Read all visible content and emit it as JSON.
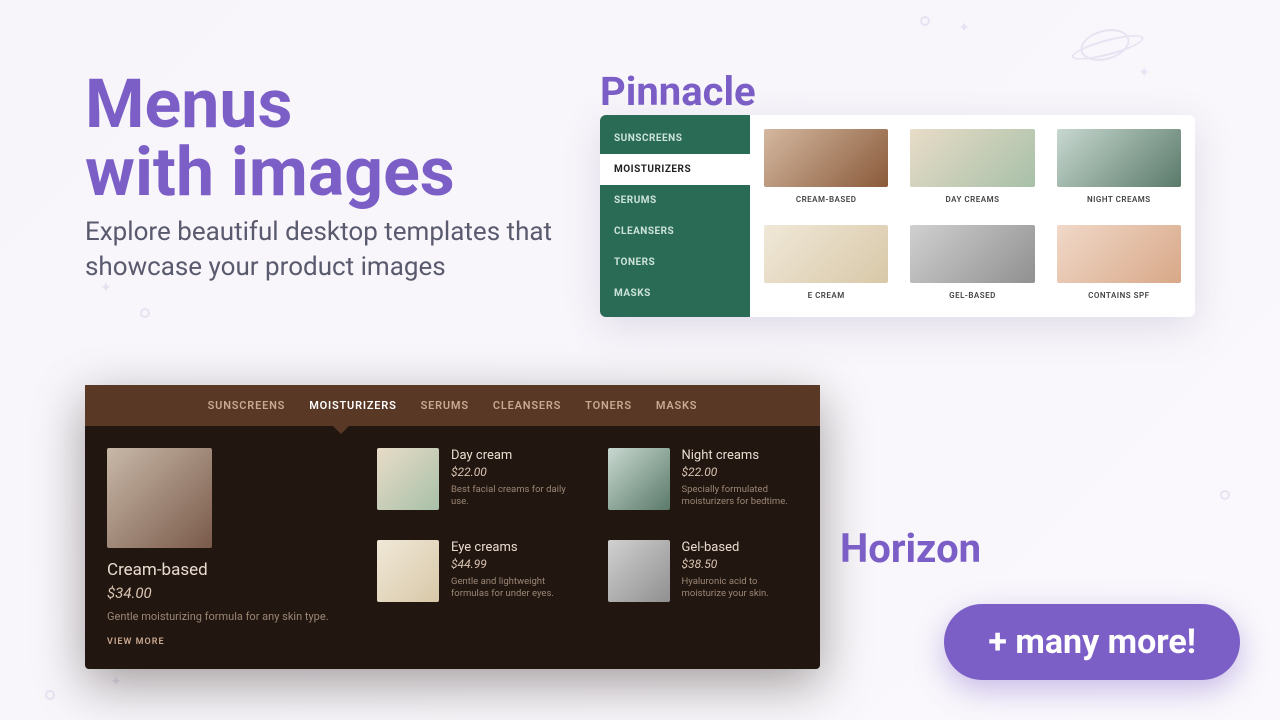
{
  "hero": {
    "title_l1": "Menus",
    "title_l2": "with images",
    "sub": "Explore beautiful desktop templates that showcase your product images"
  },
  "pinnacle": {
    "label": "Pinnacle",
    "categories": [
      "SUNSCREENS",
      "MOISTURIZERS",
      "SERUMS",
      "CLEANSERS",
      "TONERS",
      "MASKS"
    ],
    "active_index": 1,
    "cells": [
      "CREAM-BASED",
      "DAY CREAMS",
      "NIGHT CREAMS",
      "E CREAM",
      "GEL-BASED",
      "CONTAINS SPF"
    ]
  },
  "horizon": {
    "label": "Horizon",
    "tabs": [
      "SUNSCREENS",
      "MOISTURIZERS",
      "SERUMS",
      "CLEANSERS",
      "TONERS",
      "MASKS"
    ],
    "active_index": 1,
    "feature": {
      "name": "Cream-based",
      "price": "$34.00",
      "desc": "Gentle moisturizing formula for any skin type.",
      "view_more": "VIEW MORE"
    },
    "items": [
      {
        "name": "Day cream",
        "price": "$22.00",
        "desc": "Best facial creams for daily use."
      },
      {
        "name": "Eye creams",
        "price": "$44.99",
        "desc": "Gentle and lightweight formulas for under eyes."
      },
      {
        "name": "Night creams",
        "price": "$22.00",
        "desc": "Specially formulated moisturizers for bedtime."
      },
      {
        "name": "Gel-based",
        "price": "$38.50",
        "desc": "Hyaluronic acid to moisturize your skin."
      }
    ]
  },
  "cta": "+ many more!"
}
